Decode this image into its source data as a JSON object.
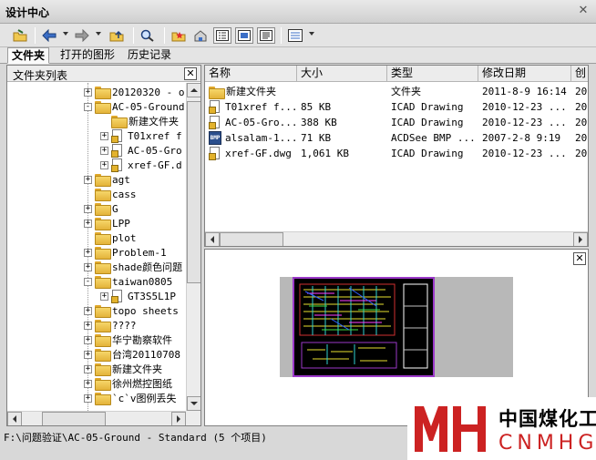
{
  "window": {
    "title": "设计中心"
  },
  "toolbar": {
    "buttons": [
      "load-icon",
      "back-icon",
      "forward-icon",
      "up-folder-icon",
      "search-icon",
      "favorites-icon",
      "home-icon",
      "tree-view-icon",
      "preview-icon",
      "description-icon",
      "views-icon"
    ]
  },
  "tabs": [
    "文件夹",
    "打开的图形",
    "历史记录"
  ],
  "folder_panel": {
    "header": "文件夹列表",
    "tree": [
      {
        "label": "20120320 - o",
        "level": 0,
        "expander": "+"
      },
      {
        "label": "AC-05-Ground",
        "level": 0,
        "expander": "-"
      },
      {
        "label": "新建文件夹",
        "level": 1,
        "expander": "",
        "icon": "folder"
      },
      {
        "label": "T01xref f",
        "level": 1,
        "expander": "+",
        "icon": "file"
      },
      {
        "label": "AC-05-Gro",
        "level": 1,
        "expander": "+",
        "icon": "file"
      },
      {
        "label": "xref-GF.d",
        "level": 1,
        "expander": "+",
        "icon": "file"
      },
      {
        "label": "agt",
        "level": 0,
        "expander": "+"
      },
      {
        "label": "cass",
        "level": 0,
        "expander": ""
      },
      {
        "label": "G",
        "level": 0,
        "expander": "+"
      },
      {
        "label": "LPP",
        "level": 0,
        "expander": "+"
      },
      {
        "label": "plot",
        "level": 0,
        "expander": ""
      },
      {
        "label": "Problem-1",
        "level": 0,
        "expander": "+"
      },
      {
        "label": "shade颜色问题",
        "level": 0,
        "expander": "+"
      },
      {
        "label": "taiwan0805",
        "level": 0,
        "expander": "-"
      },
      {
        "label": "GT3S5L1P",
        "level": 1,
        "expander": "+",
        "icon": "file"
      },
      {
        "label": "topo sheets",
        "level": 0,
        "expander": "+"
      },
      {
        "label": "????",
        "level": 0,
        "expander": "+"
      },
      {
        "label": "华宁勘察软件",
        "level": 0,
        "expander": "+"
      },
      {
        "label": "台湾20110708",
        "level": 0,
        "expander": "+"
      },
      {
        "label": "新建文件夹",
        "level": 0,
        "expander": "+"
      },
      {
        "label": "徐州燃控图纸",
        "level": 0,
        "expander": "+"
      },
      {
        "label": "`c`v图例丢失",
        "level": 0,
        "expander": "+"
      }
    ]
  },
  "file_list": {
    "columns": [
      "名称",
      "大小",
      "类型",
      "修改日期",
      "创"
    ],
    "rows": [
      {
        "name": "新建文件夹",
        "size": "",
        "type": "文件夹",
        "date": "2011-8-9 16:14",
        "extra": "20",
        "icon": "folder"
      },
      {
        "name": "T01xref f...",
        "size": "85 KB",
        "type": "ICAD Drawing",
        "date": "2010-12-23 ...",
        "extra": "20",
        "icon": "file"
      },
      {
        "name": "AC-05-Gro...",
        "size": "388 KB",
        "type": "ICAD Drawing",
        "date": "2010-12-23 ...",
        "extra": "20",
        "icon": "file"
      },
      {
        "name": "alsalam-1...",
        "size": "71 KB",
        "type": "ACDSee BMP ...",
        "date": "2007-2-8 9:19",
        "extra": "20",
        "icon": "bmp"
      },
      {
        "name": "xref-GF.dwg",
        "size": "1,061 KB",
        "type": "ICAD Drawing",
        "date": "2010-12-23 ...",
        "extra": "20",
        "icon": "file"
      }
    ]
  },
  "status": {
    "path": "F:\\问题验证\\AC-05-Ground - Standard",
    "count": "(5  个项目)"
  },
  "watermark": {
    "cn": "中国煤化工",
    "en": "CNMHG"
  },
  "colors": {
    "folder": "#f0c850",
    "accent_red": "#cc2222",
    "thumb_border": "#9b39c9"
  }
}
